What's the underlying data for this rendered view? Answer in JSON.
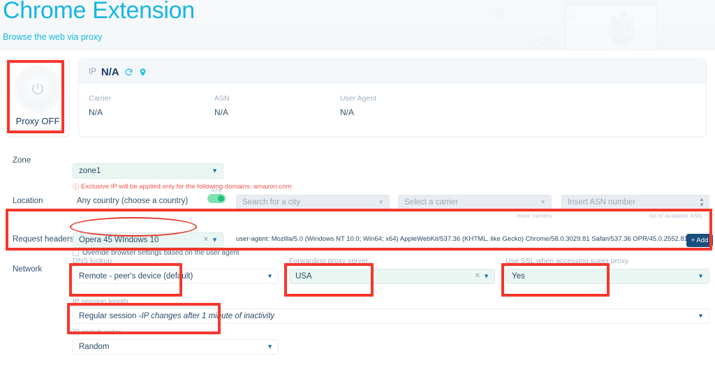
{
  "hero": {
    "title": "Chrome Extension",
    "subtitle": "Browse the web via proxy"
  },
  "power": {
    "icon": "power-icon",
    "label": "Proxy OFF"
  },
  "ip_panel": {
    "ip_label": "IP",
    "ip_value": "N/A",
    "refresh_icon": "refresh-icon",
    "location_icon": "map-pin-icon",
    "fields": [
      {
        "label": "Carrier",
        "value": "N/A"
      },
      {
        "label": "ASN",
        "value": "N/A"
      },
      {
        "label": "User Agent",
        "value": "N/A"
      }
    ]
  },
  "zone": {
    "label": "Zone",
    "value": "zone1",
    "warning_icon": "info-circle-icon",
    "warning": "Exclusive IP will be applied only for the following domains: amazon.com"
  },
  "location": {
    "label": "Location",
    "country_value": "Any country (choose a country)",
    "any_toggle_label": "Any",
    "city_placeholder": "Search for a city",
    "carrier_placeholder": "Select a carrier",
    "asn_placeholder": "Insert ASN number",
    "carrier_hint": "more carriers",
    "asn_hint": "list of available ASN"
  },
  "request_headers": {
    "label": "Request headers",
    "value": "Opera 45 WIndows 10",
    "user_agent": "user-agent: Mozilla/5.0 (Windows NT 10.0; Win64; x64) AppleWebKit/537.36 (KHTML, like Gecko) Chrome/58.0.3029.81 Safari/537.36 OPR/45.0.2552.812",
    "add_button": "+ Add",
    "override_checkbox": "Override browser settings based on the user agent"
  },
  "network": {
    "label": "Network",
    "dns_lookup": {
      "label": "DNS lookup",
      "value": "Remote - peer's device (default)"
    },
    "forwarding_proxy": {
      "label": "Forwarding proxy server",
      "value": "USA"
    },
    "use_ssl": {
      "label": "Use SSL when accessing super proxy",
      "value": "Yes"
    },
    "ip_session_length": {
      "label": "IP session length",
      "value_prefix": "Regular session - ",
      "value_italic": "IP changes after 1 minute of inactivity"
    },
    "ip_switch_order": {
      "label": "IP switch order",
      "value": "Random"
    }
  },
  "colors": {
    "brand": "#17b6e0",
    "annotation": "#f5372b",
    "accent_dark": "#1b4f7e",
    "field_green": "#eaf6f2",
    "toggle_on": "#19c37d",
    "warning": "#f2544c"
  }
}
